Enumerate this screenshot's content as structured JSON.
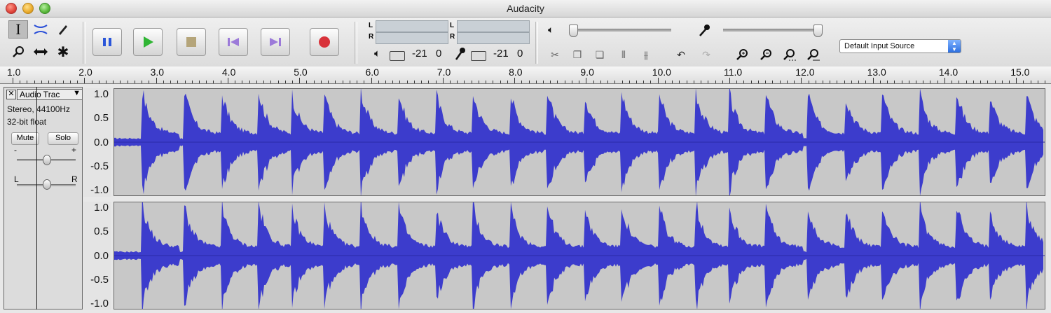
{
  "window": {
    "title": "Audacity"
  },
  "tools": [
    {
      "name": "selection-tool-icon",
      "glyph": "I"
    },
    {
      "name": "envelope-tool-icon",
      "glyph": "⇕"
    },
    {
      "name": "draw-tool-icon",
      "glyph": "✎"
    },
    {
      "name": "zoom-tool-icon",
      "glyph": "⚲"
    },
    {
      "name": "timeshift-tool-icon",
      "glyph": "↔"
    },
    {
      "name": "multi-tool-icon",
      "glyph": "✱"
    }
  ],
  "transport": {
    "pause_icon": "pause-icon",
    "play_icon": "play-icon",
    "stop_icon": "stop-icon",
    "skip_start_icon": "skip-to-start-icon",
    "skip_end_icon": "skip-to-end-icon",
    "record_icon": "record-icon"
  },
  "meters": {
    "playback": {
      "left_label": "L",
      "right_label": "R",
      "db": "-21",
      "zero": "0"
    },
    "record": {
      "left_label": "L",
      "right_label": "R",
      "db": "-21",
      "zero": "0"
    }
  },
  "mixer": {
    "input_source": "Default Input Source",
    "output_volume_fraction": 0.0,
    "input_volume_fraction": 1.0
  },
  "ruler": {
    "labels": [
      "1.0",
      "2.0",
      "3.0",
      "4.0",
      "5.0",
      "6.0",
      "7.0",
      "8.0",
      "9.0",
      "10.0",
      "11.0",
      "12.0",
      "13.0",
      "14.0",
      "15.0"
    ]
  },
  "track": {
    "name": "Audio Trac",
    "format_line": "Stereo, 44100Hz",
    "bit_depth": "32-bit float",
    "mute_label": "Mute",
    "solo_label": "Solo",
    "gain_minus": "-",
    "gain_plus": "+",
    "pan_left": "L",
    "pan_right": "R",
    "gain_fraction": 0.5,
    "pan_fraction": 0.5,
    "scale_labels": [
      "1.0",
      "0.5",
      "0.0",
      "-0.5",
      "-1.0"
    ],
    "wave_color": "#3c3ccc"
  }
}
